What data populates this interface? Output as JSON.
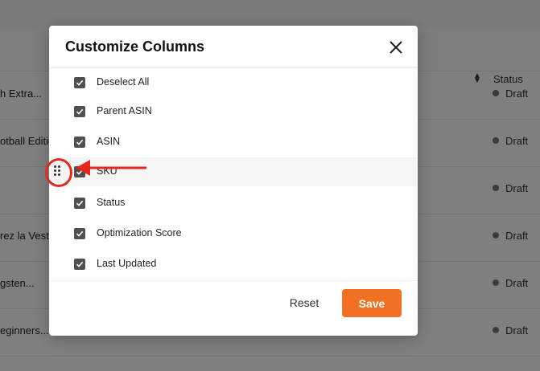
{
  "background_table": {
    "status_header": "Status",
    "rows": [
      {
        "name": "h Extra...",
        "status": "Draft"
      },
      {
        "name": "otball Editio...",
        "status": "Draft"
      },
      {
        "name": "",
        "status": "Draft"
      },
      {
        "name": "rez la Vest...",
        "status": "Draft"
      },
      {
        "name": "gsten...",
        "status": "Draft"
      },
      {
        "name": "eginners...",
        "status": "Draft"
      }
    ]
  },
  "modal": {
    "title": "Customize Columns",
    "columns": [
      {
        "label": "Deselect All",
        "checked": true
      },
      {
        "label": "Parent ASIN",
        "checked": true
      },
      {
        "label": "ASIN",
        "checked": true
      },
      {
        "label": "SKU",
        "checked": true
      },
      {
        "label": "Status",
        "checked": true
      },
      {
        "label": "Optimization Score",
        "checked": true
      },
      {
        "label": "Last Updated",
        "checked": true
      }
    ],
    "reset_label": "Reset",
    "save_label": "Save"
  },
  "colors": {
    "accent": "#f07124",
    "annotation": "#e02a1f",
    "checkbox": "#505050"
  },
  "icons": {
    "close": "close-icon",
    "check": "check-icon",
    "drag": "drag-handle-icon",
    "sort": "sort-icon"
  }
}
